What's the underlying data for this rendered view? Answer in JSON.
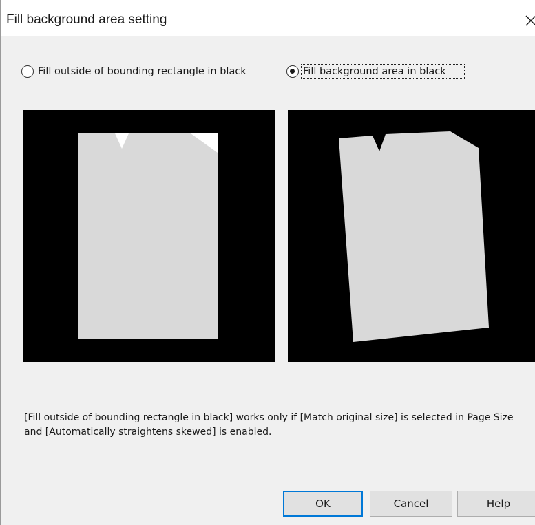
{
  "window": {
    "title": "Fill background area setting",
    "close_icon": "close-icon"
  },
  "options": {
    "outside_bounding_label": "Fill outside of bounding rectangle in black",
    "outside_bounding_selected": false,
    "background_area_label": "Fill background area in black",
    "background_area_selected": true
  },
  "previews": {
    "left": "preview-outside-bounding-rectangle",
    "right": "preview-background-area"
  },
  "note": "[Fill outside of bounding rectangle in black] works only if [Match original size] is selected in Page Size and [Automatically straightens skewed] is enabled.",
  "buttons": {
    "ok": "OK",
    "cancel": "Cancel",
    "help": "Help"
  },
  "colors": {
    "dialog_bg": "#f0f0f0",
    "preview_bg": "#000000",
    "page_fill": "#d9d9d9",
    "default_button_border": "#0078d7"
  }
}
